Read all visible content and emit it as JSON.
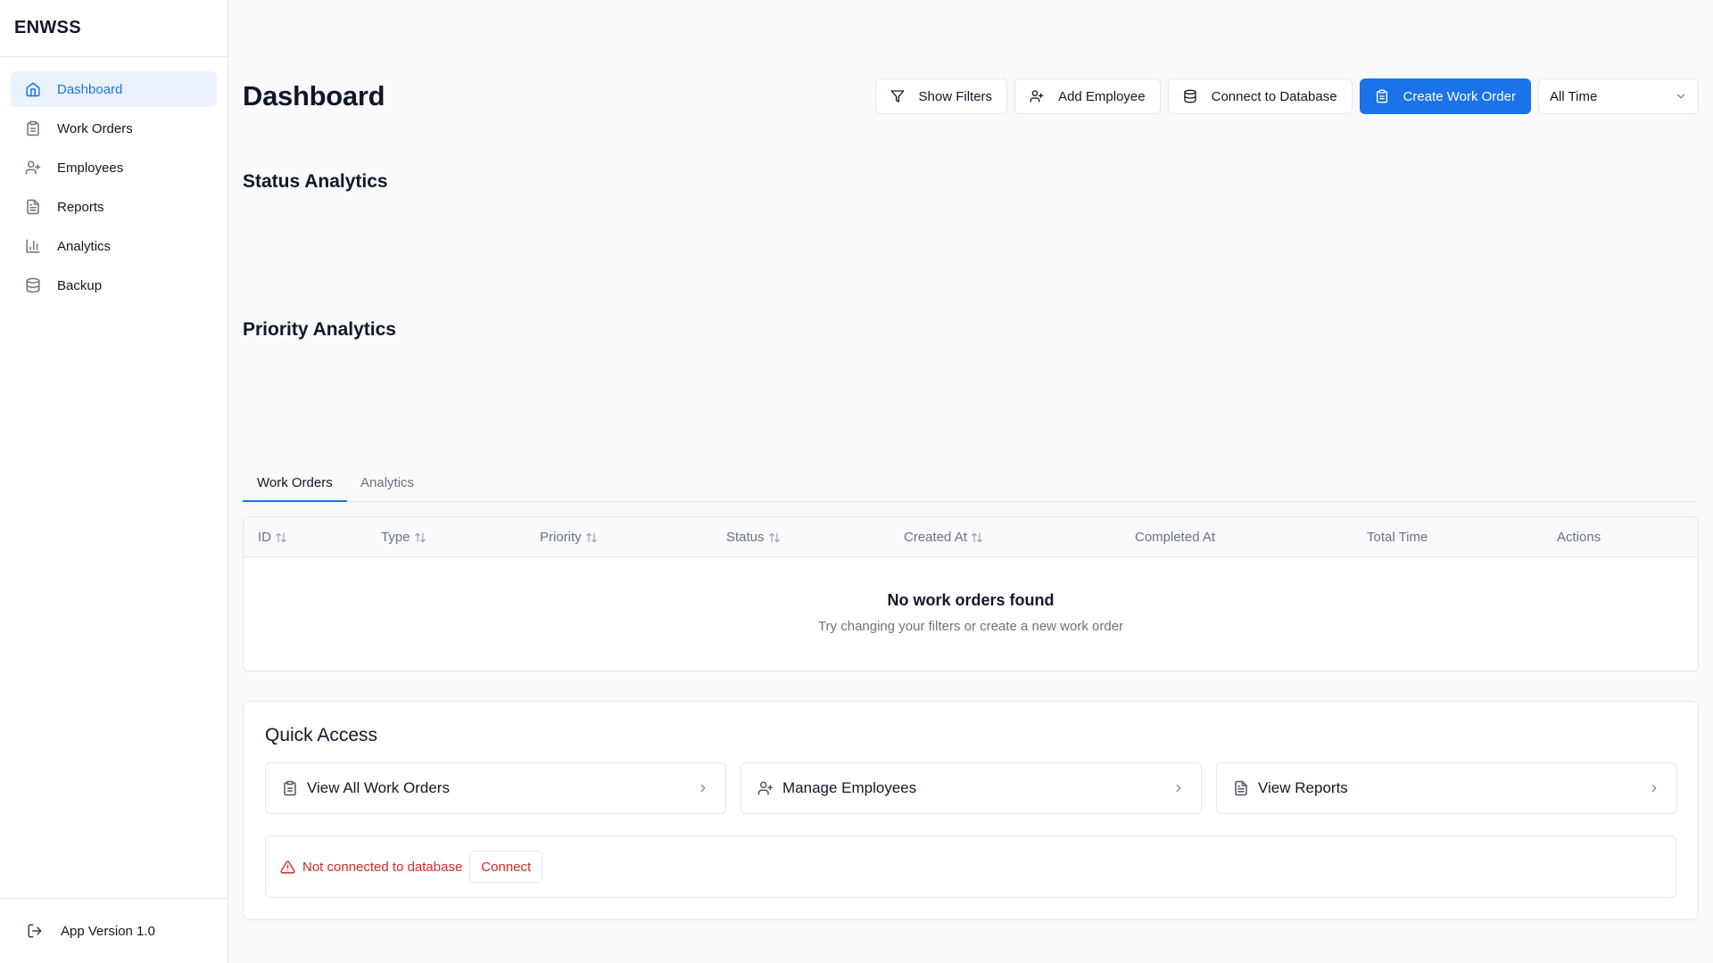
{
  "app": {
    "title": "ENWSS",
    "version_label": "App Version 1.0"
  },
  "sidebar": {
    "items": [
      {
        "label": "Dashboard",
        "icon": "home-icon",
        "active": true
      },
      {
        "label": "Work Orders",
        "icon": "clipboard-icon"
      },
      {
        "label": "Employees",
        "icon": "user-plus-icon"
      },
      {
        "label": "Reports",
        "icon": "file-text-icon"
      },
      {
        "label": "Analytics",
        "icon": "bar-chart-icon"
      },
      {
        "label": "Backup",
        "icon": "database-icon"
      }
    ]
  },
  "header": {
    "title": "Dashboard",
    "show_filters": "Show Filters",
    "add_employee": "Add Employee",
    "connect_db": "Connect to Database",
    "create_work_order": "Create Work Order",
    "time_range": "All Time"
  },
  "sections": {
    "status_analytics": "Status Analytics",
    "priority_analytics": "Priority Analytics"
  },
  "tabs": [
    {
      "label": "Work Orders",
      "active": true
    },
    {
      "label": "Analytics",
      "active": false
    }
  ],
  "table": {
    "columns": [
      "ID",
      "Type",
      "Priority",
      "Status",
      "Created At",
      "Completed At",
      "Total Time",
      "Actions"
    ],
    "empty_title": "No work orders found",
    "empty_subtitle": "Try changing your filters or create a new work order"
  },
  "quick_access": {
    "title": "Quick Access",
    "items": [
      {
        "label": "View All Work Orders",
        "icon": "clipboard-icon"
      },
      {
        "label": "Manage Employees",
        "icon": "user-plus-icon"
      },
      {
        "label": "View Reports",
        "icon": "file-text-icon"
      }
    ],
    "db_status": "Not connected to database",
    "connect_label": "Connect"
  },
  "colors": {
    "accent": "#1a73e8",
    "danger": "#dc2626",
    "active_bg": "#eaf2fd",
    "border": "#e5e7eb",
    "background": "#f8fafc"
  }
}
